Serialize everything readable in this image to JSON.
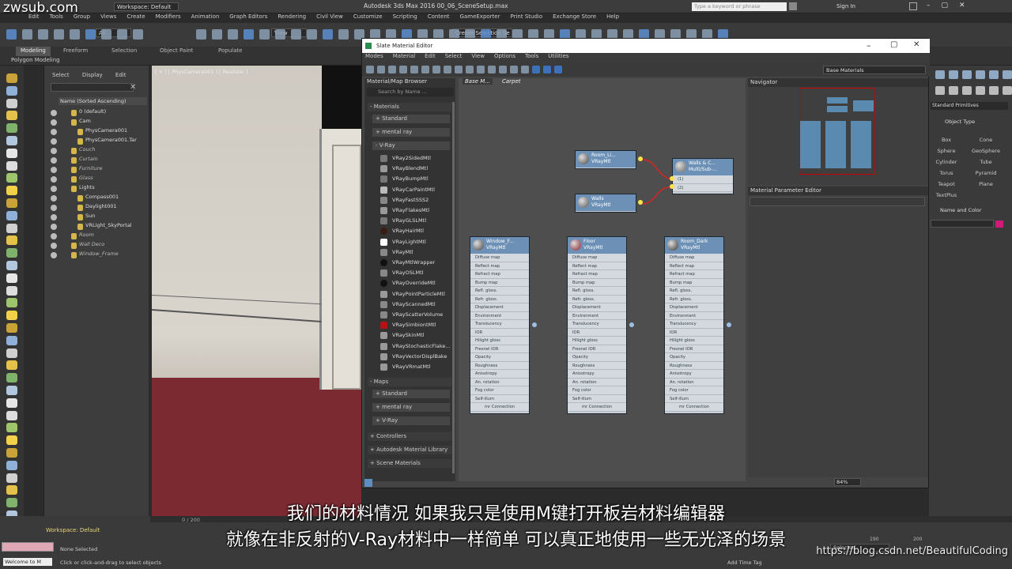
{
  "watermark_tl": "zwsub.com",
  "app_title": "Autodesk 3ds Max 2016     00_06_SceneSetup.max",
  "menu": [
    "Edit",
    "Tools",
    "Group",
    "Views",
    "Create",
    "Modifiers",
    "Animation",
    "Graph Editors",
    "Rendering",
    "Civil View",
    "Customize",
    "Scripting",
    "Content",
    "GameExporter",
    "Print Studio",
    "Exchange Store",
    "Help"
  ],
  "workspace": "Workspace: Default",
  "search_placeholder": "Type a keyword or phrase",
  "sign_in": "Sign In",
  "toolbar": {
    "filter": "All",
    "view": "View",
    "selection_set": "Create Selection Se"
  },
  "ribbon": {
    "tabs": [
      "Modeling",
      "Freeform",
      "Selection",
      "Object Paint",
      "Populate"
    ],
    "sub": "Polygon Modeling"
  },
  "explorer": {
    "tabs": [
      "Select",
      "Display",
      "Edit"
    ],
    "header": "Name (Sorted Ascending)",
    "rows": [
      "0 (default)",
      "Cam",
      "PhysCamera001",
      "PhysCamera001.Tar",
      "Couch",
      "Curtain",
      "Furniture",
      "Glass",
      "Lights",
      "Compass001",
      "Daylight001",
      "Sun",
      "VRLight_SkyPortal",
      "Room",
      "Wall Deco",
      "Window_Frame"
    ]
  },
  "viewport_label": "[ + ] [ PhysCamera001 ] [ Realistic ]",
  "slate": {
    "title": "Slate Material Editor",
    "menus": [
      "Modes",
      "Material",
      "Edit",
      "Select",
      "View",
      "Options",
      "Tools",
      "Utilities"
    ],
    "dropdown": "Base Materials",
    "browser_title": "Material/Map Browser",
    "browser_search": "Search by Name ...",
    "materials_label": "- Materials",
    "standard": "+ Standard",
    "mentalray": "+ mental ray",
    "vray": "- V-Ray",
    "vray_items": [
      "VRay2SidedMtl",
      "VRayBlendMtl",
      "VRayBumpMtl",
      "VRayCarPaintMtl",
      "VRayFastSSS2",
      "VRayFlakesMtl",
      "VRayGLSLMtl",
      "VRayHairMtl",
      "VRayLightMtl",
      "VRayMtl",
      "VRayMtlWrapper",
      "VRayOSLMtl",
      "VRayOverrideMtl",
      "VRayPointParticleMtl",
      "VRayScannedMtl",
      "VRayScatterVolume",
      "VRaySimbiontMtl",
      "VRaySkinMtl",
      "VRayStochasticFlake...",
      "VRayVectorDisplBake",
      "VRayVRmatMtl"
    ],
    "maps_label": "- Maps",
    "maps_standard": "+ Standard",
    "maps_mentalray": "+ mental ray",
    "maps_vray": "+ V-Ray",
    "controllers": "+ Controllers",
    "autodesk_lib": "+ Autodesk Material Library",
    "scene_materials": "+ Scene Materials",
    "view_tabs": [
      "Base M...",
      "Carpet"
    ],
    "navigator": "Navigator",
    "param_editor": "Material Parameter Editor",
    "zoom": "84%",
    "nodes": [
      {
        "name": "Room_Li...",
        "type": "VRayMtl"
      },
      {
        "name": "Walls",
        "type": "VRayMtl"
      },
      {
        "name": "Walls & C...",
        "type": "Multi/Sub-..."
      },
      {
        "name": "Window_F...",
        "type": "VRayMtl"
      },
      {
        "name": "Floor",
        "type": "VRayMtl"
      },
      {
        "name": "Room_Dark",
        "type": "VRayMtl"
      }
    ],
    "multi_slots": [
      "(1)",
      "(2)"
    ],
    "slots": [
      "Diffuse map",
      "Reflect map",
      "Refract map",
      "Bump map",
      "Refl. gloss.",
      "Refr. gloss.",
      "Displacement",
      "Environment",
      "Translucency",
      "IOR",
      "Hilight gloss",
      "Fresnel IOR",
      "Opacity",
      "Roughness",
      "Anisotropy",
      "An. rotation",
      "Fog color",
      "Self-illum"
    ],
    "slot_footer": "mr Connection"
  },
  "right_panel": {
    "dropdown": "Standard Primitives",
    "object_type": "Object Type",
    "buttons": [
      "Box",
      "Cone",
      "Sphere",
      "GeoSphere",
      "Cylinder",
      "Tube",
      "Torus",
      "Pyramid",
      "Teapot",
      "Plane",
      "TextPlus"
    ],
    "name_color": "Name and Color"
  },
  "bottom": {
    "workspace": "Workspace: Default",
    "frame": "0 / 200",
    "welcome": "Welcome to M",
    "none_selected": "None Selected",
    "status": "Click or click-and-drag to select objects",
    "add_time_tag": "Add Time Tag",
    "selected": "Selected",
    "tick_190": "190",
    "tick_200": "200"
  },
  "subtitle_1": "我们的材料情况  如果我只是使用M键打开板岩材料编辑器",
  "subtitle_2": "就像在非反射的V-Ray材料中一样简单  可以真正地使用一些无光泽的场景",
  "watermark_br": "https://blog.csdn.net/BeautifulCoding"
}
